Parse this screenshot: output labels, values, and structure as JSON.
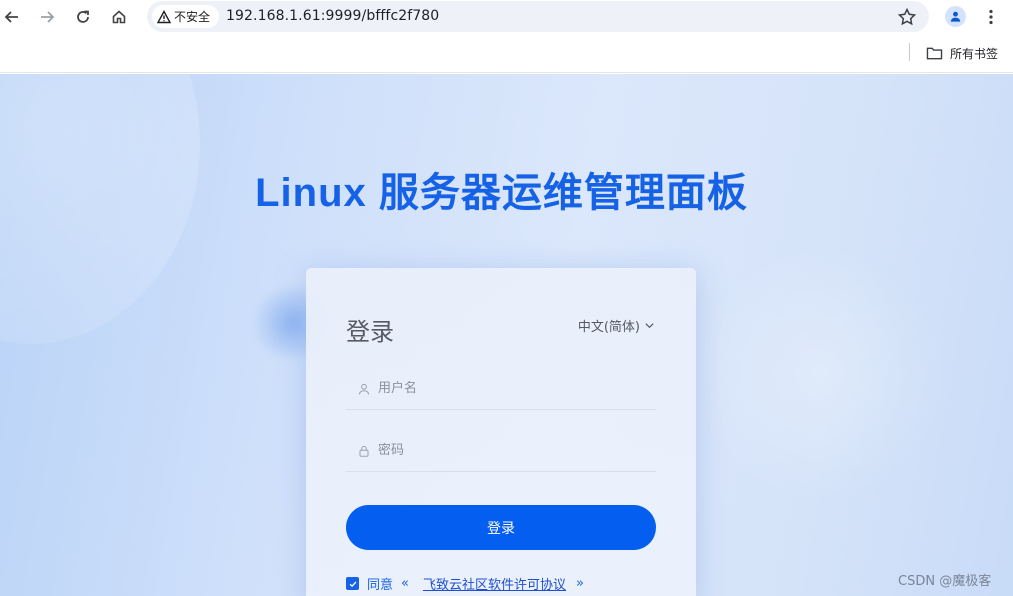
{
  "browser": {
    "security_label": "不安全",
    "url": "192.168.1.61:9999/bfffc2f780",
    "bookmarks_folder_label": "所有书签"
  },
  "page": {
    "title": "Linux 服务器运维管理面板"
  },
  "login": {
    "heading": "登录",
    "language": "中文(简体)",
    "username_placeholder": "用户名",
    "password_placeholder": "密码",
    "submit_label": "登录",
    "agree_prefix": "同意",
    "quote_open": "«",
    "license_link": "飞致云社区软件许可协议",
    "quote_close": "»",
    "agreed": true
  },
  "watermark": "CSDN @魔极客",
  "colors": {
    "accent": "#045ef0",
    "title": "#1662e6"
  }
}
